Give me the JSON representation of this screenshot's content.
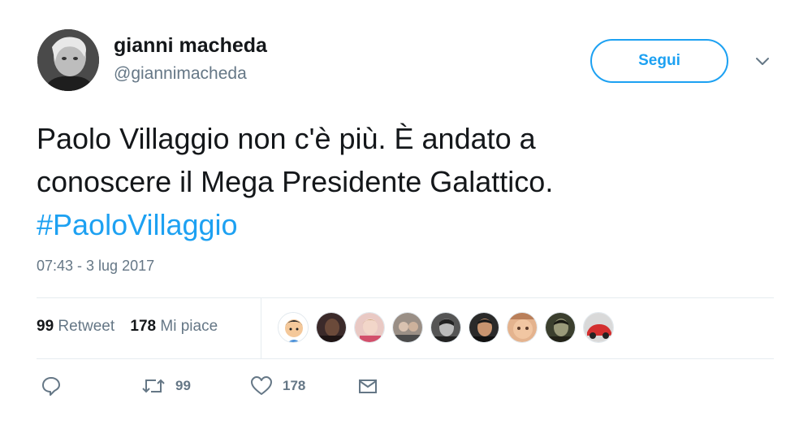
{
  "user": {
    "name": "gianni macheda",
    "handle": "@giannimacheda",
    "follow_label": "Segui"
  },
  "tweet": {
    "lines": [
      "Paolo Villaggio non c'è più. È andato a",
      "conoscere il Mega Presidente Galattico."
    ],
    "hashtag": "#PaoloVillaggio",
    "timestamp": "07:43 - 3 lug 2017"
  },
  "stats": {
    "retweets": "99",
    "retweet_label": "Retweet",
    "likes": "178",
    "likes_label": "Mi piace"
  },
  "actions": {
    "retweet_count": "99",
    "like_count": "178"
  },
  "colors": {
    "accent": "#1da1f2",
    "text": "#14171a",
    "muted": "#657786",
    "divider": "#e6ecf0"
  }
}
